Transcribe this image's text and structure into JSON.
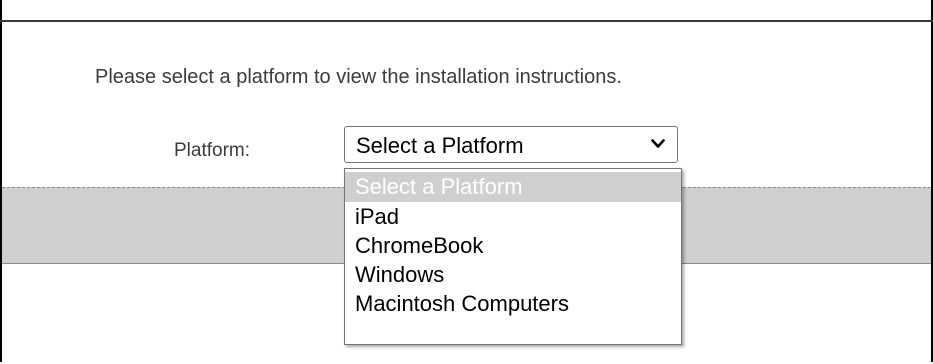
{
  "page": {
    "instructions": "Please select a platform to view the installation instructions.",
    "platform_label": "Platform:"
  },
  "platform_select": {
    "selected_value": "Select a Platform",
    "options": [
      {
        "label": "Select a Platform",
        "highlighted": true
      },
      {
        "label": "iPad",
        "highlighted": false
      },
      {
        "label": "ChromeBook",
        "highlighted": false
      },
      {
        "label": "Windows",
        "highlighted": false
      },
      {
        "label": "Macintosh Computers",
        "highlighted": false
      }
    ]
  },
  "icons": {
    "select_arrow": "chevron-down-icon"
  },
  "colors": {
    "band": "#cfcfcf",
    "highlight": "#cfcfcf",
    "text": "#3b3b3b"
  }
}
